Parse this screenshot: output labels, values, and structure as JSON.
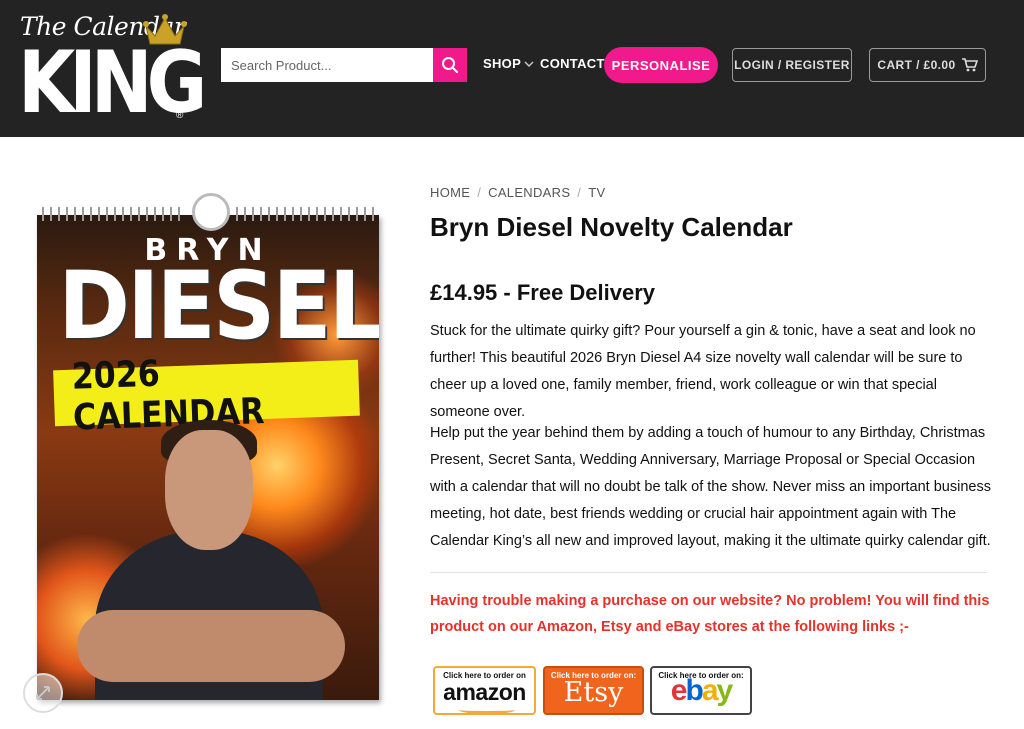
{
  "header": {
    "logo_small": "The Calendar",
    "logo_big": "KING",
    "logo_reg": "®",
    "search_placeholder": "Search Product...",
    "nav": {
      "shop": "SHOP",
      "contact": "CONTACT"
    },
    "personalise": "PERSONALISE",
    "login": "LOGIN / REGISTER",
    "cart": "CART / £0.00"
  },
  "product_image": {
    "line1": "BRYN",
    "line2": "DIESEL",
    "line3": "2026 CALENDAR"
  },
  "breadcrumb": [
    "HOME",
    "CALENDARS",
    "TV"
  ],
  "product": {
    "title": "Bryn Diesel Novelty Calendar",
    "price": "£14.95 - Free Delivery",
    "description_1": "Stuck for the ultimate quirky gift? Pour yourself a gin & tonic, have a seat and look no further! This beautiful 2026 Bryn Diesel A4 size novelty wall calendar will be sure to cheer up a loved one, family member, friend, work colleague or win that special someone over.",
    "description_2": "Help put the year behind them by adding a touch of humour to any Birthday, Christmas Present, Secret Santa, Wedding Anniversary, Marriage Proposal or Special Occasion with a calendar that will no doubt be talk of the show. Never miss an important business meeting, hot date, best friends wedding or crucial hair appointment again with The Calendar King’s all new and improved layout, making it the ultimate quirky calendar gift.",
    "trouble": "Having trouble making a purchase on our website? No problem! You will find this product on our Amazon, Etsy and eBay stores at the following links ;-"
  },
  "stores": {
    "amazon": {
      "small": "Click here to order on",
      "name": "amazon"
    },
    "etsy": {
      "small": "Click here to order on:",
      "name": "Etsy"
    },
    "ebay": {
      "small": "Click here to order on:",
      "name": "ebay"
    }
  },
  "colors": {
    "header_bg": "#232323",
    "accent_pink": "#f01a8c",
    "alert_red": "#e8312a",
    "banner_yellow": "#f4ee18"
  },
  "icons": [
    "crown-icon",
    "search-icon",
    "chevron-down-icon",
    "cart-icon",
    "zoom-icon"
  ]
}
